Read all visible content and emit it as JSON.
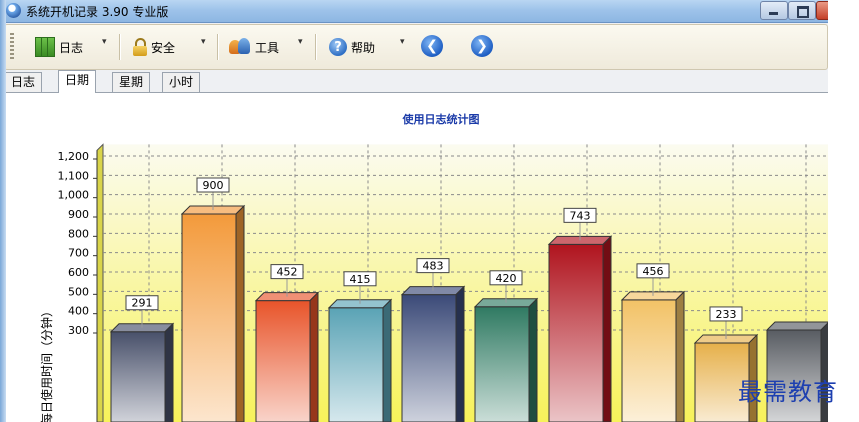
{
  "window": {
    "title": "系统开机记录 3.90 专业版"
  },
  "toolbar": {
    "items": [
      {
        "label": "日志",
        "icon": "log-grid-icon"
      },
      {
        "label": "安全",
        "icon": "lock-icon"
      },
      {
        "label": "工具",
        "icon": "tools-icon"
      },
      {
        "label": "帮助",
        "icon": "help-icon"
      }
    ],
    "back_icon": "back-arrow-icon",
    "forward_icon": "forward-arrow-icon",
    "drop_glyph": "▾"
  },
  "tabs": [
    {
      "label": "日志",
      "active": false
    },
    {
      "label": "日期",
      "active": true
    },
    {
      "label": "星期",
      "active": false
    },
    {
      "label": "小时",
      "active": false
    }
  ],
  "chart_data": {
    "type": "bar",
    "title": "使用日志统计图",
    "ylabel": "每日使用时间（分钟）",
    "xlabel": "",
    "y_ticks": [
      "300",
      "400",
      "500",
      "600",
      "700",
      "800",
      "900",
      "1,000",
      "1,100",
      "1,200"
    ],
    "ylim": [
      270,
      1260
    ],
    "grid": true,
    "values": [
      291,
      900,
      452,
      415,
      483,
      420,
      743,
      456,
      233,
      300
    ],
    "value_labels": [
      "291",
      "900",
      "452",
      "415",
      "483",
      "420",
      "743",
      "456",
      "233",
      ""
    ],
    "bar_colors": [
      "#48506a",
      "#f39a3b",
      "#e8542a",
      "#5aa3b5",
      "#3b4a78",
      "#2f7a62",
      "#b0141e",
      "#f2c266",
      "#e6b04a",
      "#585c62"
    ]
  },
  "watermark": "最需教育"
}
